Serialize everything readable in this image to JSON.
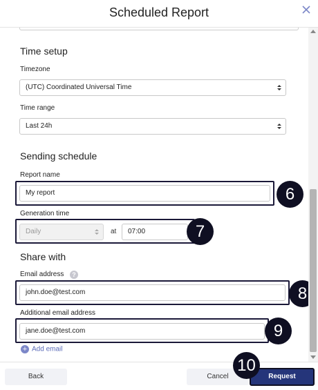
{
  "dialog": {
    "title": "Scheduled Report"
  },
  "time_setup": {
    "heading": "Time setup",
    "timezone_label": "Timezone",
    "timezone_value": "(UTC) Coordinated Universal Time",
    "time_range_label": "Time range",
    "time_range_value": "Last 24h"
  },
  "sending_schedule": {
    "heading": "Sending schedule",
    "report_name_label": "Report name",
    "report_name_value": "My report",
    "generation_time_label": "Generation time",
    "frequency_value": "Daily",
    "at_label": "at",
    "time_value": "07:00"
  },
  "share_with": {
    "heading": "Share with",
    "email_label": "Email address",
    "help_symbol": "?",
    "email_value": "john.doe@test.com",
    "additional_email_label": "Additional email address",
    "additional_email_value": "jane.doe@test.com",
    "add_email_label": "Add email"
  },
  "footer": {
    "back_label": "Back",
    "cancel_label": "Cancel",
    "request_label": "Request"
  },
  "step_badges": {
    "report_name": "6",
    "generation_time": "7",
    "email": "8",
    "additional_email": "9",
    "request": "10"
  },
  "colors": {
    "accent": "#25357a",
    "highlight_border": "#1a1838",
    "badge": "#0f0f22",
    "link": "#5a6ab8"
  },
  "icons": {
    "close": "close-icon",
    "help": "help-icon",
    "add": "plus-icon",
    "select_arrows": "updown-arrows-icon"
  }
}
